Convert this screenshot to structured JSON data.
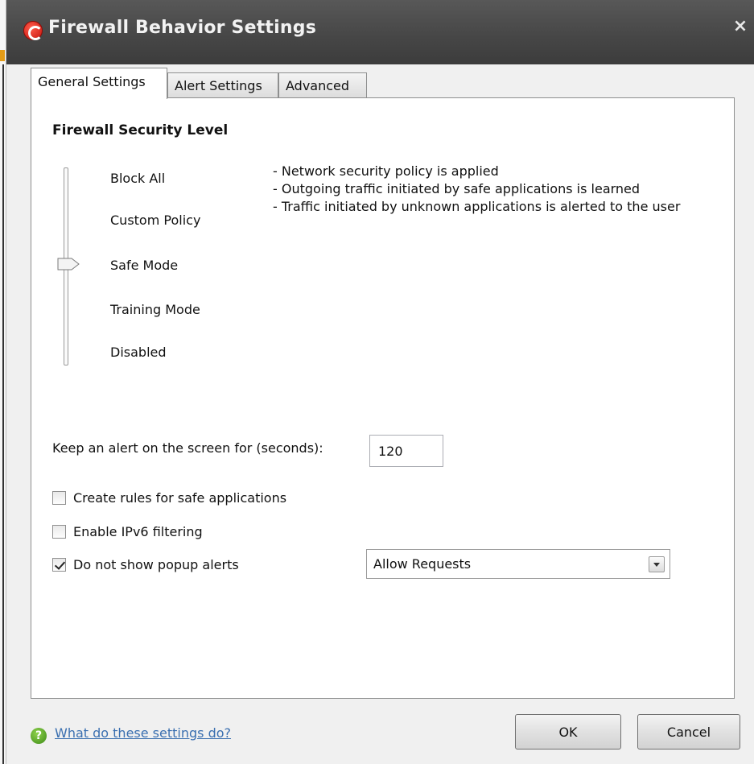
{
  "window": {
    "title": "Firewall Behavior Settings",
    "close_glyph": "×",
    "icon": "comodo-logo-icon"
  },
  "tabs": [
    {
      "label": "General Settings",
      "active": true
    },
    {
      "label": "Alert Settings",
      "active": false
    },
    {
      "label": "Advanced",
      "active": false
    }
  ],
  "security": {
    "heading": "Firewall Security Level",
    "levels": [
      "Block All",
      "Custom Policy",
      "Safe Mode",
      "Training Mode",
      "Disabled"
    ],
    "selected_level": "Safe Mode",
    "description": [
      "- Network security policy is applied",
      "- Outgoing traffic initiated by safe applications is learned",
      "- Traffic initiated by unknown applications is alerted to the user"
    ]
  },
  "alert": {
    "label": "Keep an alert on the screen for (seconds):",
    "value": "120"
  },
  "options": [
    {
      "label": "Create rules for safe applications",
      "checked": false
    },
    {
      "label": "Enable IPv6 filtering",
      "checked": false
    },
    {
      "label": "Do not show popup alerts",
      "checked": true
    }
  ],
  "popup_action": {
    "selected": "Allow Requests"
  },
  "footer": {
    "help_link": "What do these settings do?",
    "ok": "OK",
    "cancel": "Cancel"
  },
  "colors": {
    "title_bar": "#474747",
    "link": "#3a6fb0",
    "logo_red": "#c5140c",
    "help_green": "#3c8a17"
  }
}
